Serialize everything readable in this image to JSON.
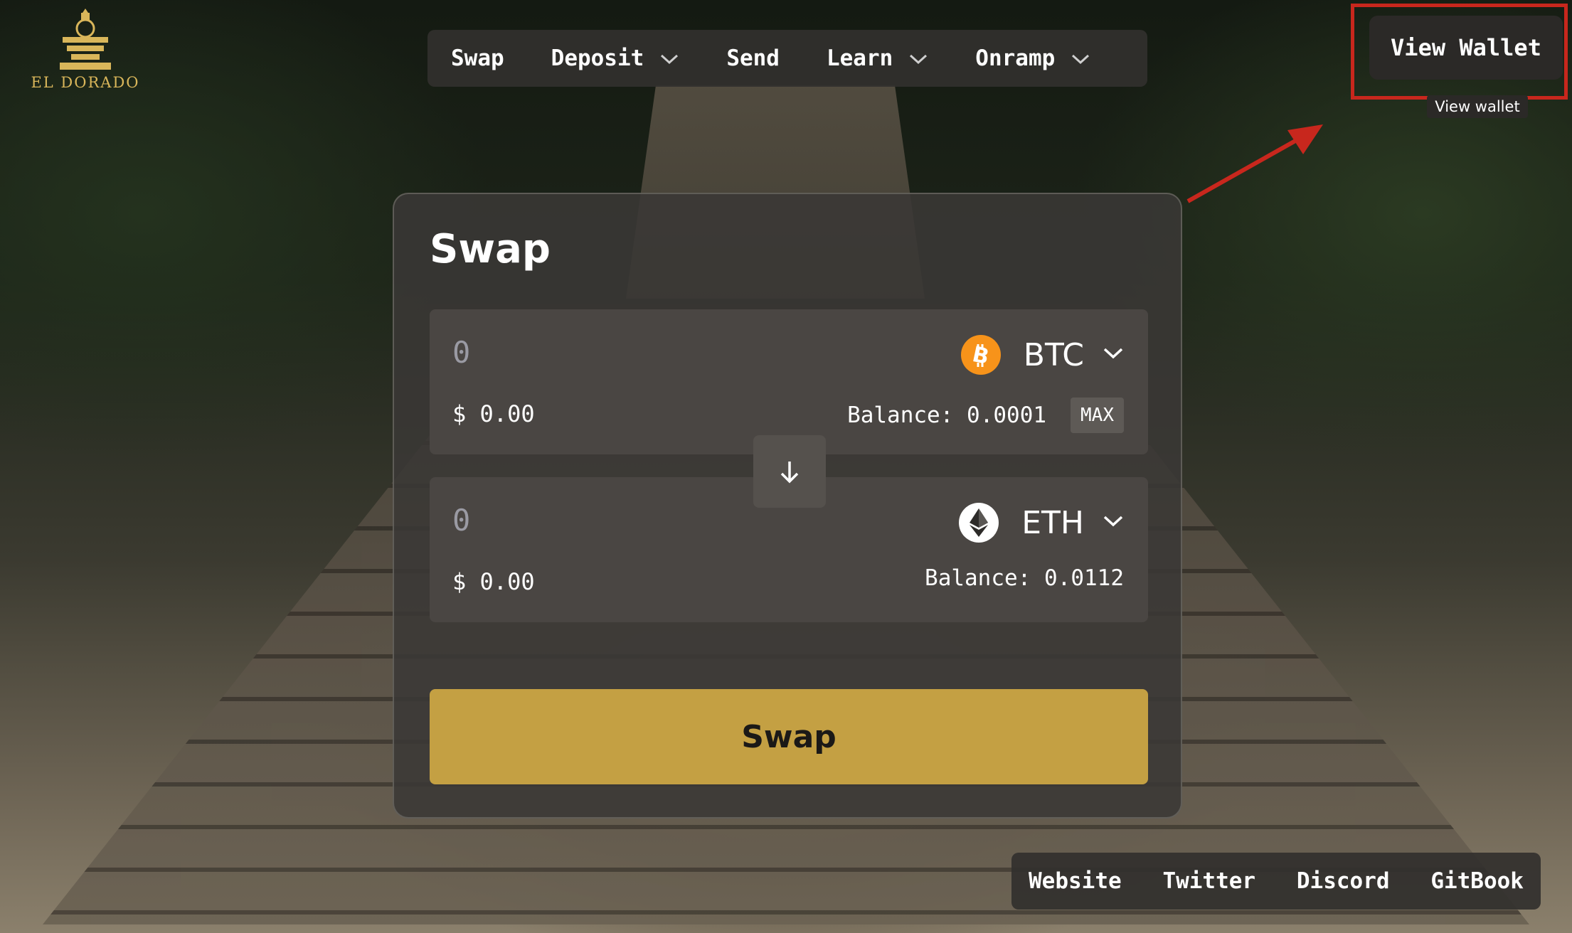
{
  "brand": {
    "name": "EL DORADO",
    "logo_icon": "el-dorado-temple-logo"
  },
  "nav": {
    "items": [
      {
        "label": "Swap",
        "has_dropdown": false
      },
      {
        "label": "Deposit",
        "has_dropdown": true
      },
      {
        "label": "Send",
        "has_dropdown": false
      },
      {
        "label": "Learn",
        "has_dropdown": true
      },
      {
        "label": "Onramp",
        "has_dropdown": true
      }
    ]
  },
  "wallet": {
    "button_label": "View Wallet",
    "tooltip": "View wallet",
    "highlight_color": "#c8271d"
  },
  "swap": {
    "title": "Swap",
    "from": {
      "amount_placeholder": "0",
      "usd_value": "$ 0.00",
      "token": "BTC",
      "token_icon": "bitcoin-icon",
      "token_color": "#f7931a",
      "balance": "Balance: 0.0001",
      "max_label": "MAX"
    },
    "to": {
      "amount_placeholder": "0",
      "usd_value": "$ 0.00",
      "token": "ETH",
      "token_icon": "ethereum-icon",
      "token_color": "#ffffff",
      "balance": "Balance: 0.0112"
    },
    "switch_icon": "arrow-down-icon",
    "submit_label": "Swap",
    "accent_color": "#c4a043"
  },
  "footer": {
    "links": [
      "Website",
      "Twitter",
      "Discord",
      "GitBook"
    ]
  }
}
